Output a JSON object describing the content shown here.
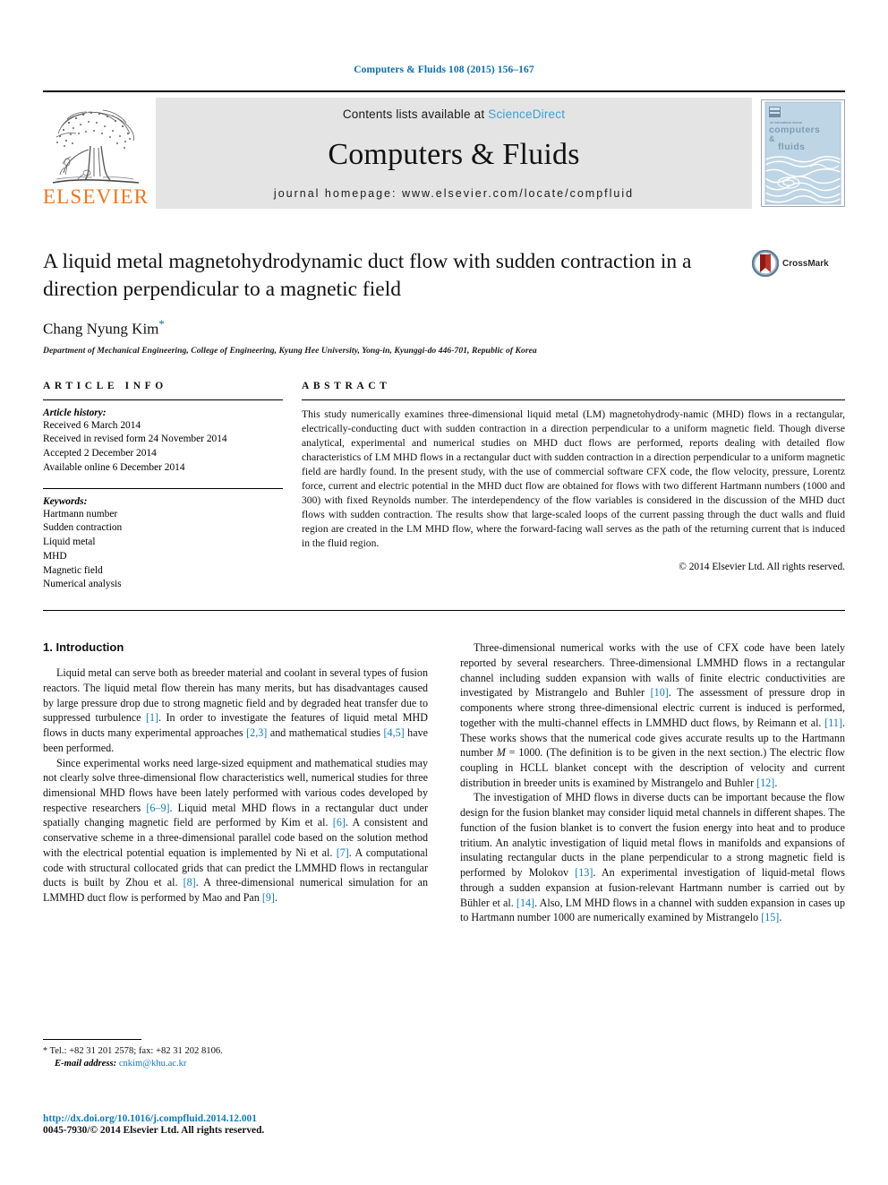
{
  "running_head": "Computers & Fluids 108 (2015) 156–167",
  "masthead": {
    "publisher_name": "ELSEVIER",
    "contents_prefix": "Contents lists available at ",
    "sciencedirect": "ScienceDirect",
    "journal_title": "Computers & Fluids",
    "homepage": "journal homepage: www.elsevier.com/locate/compfluid",
    "cover_line1": "An International Journal",
    "cover_line2": "computers",
    "cover_line3": "&",
    "cover_line4": "fluids"
  },
  "article": {
    "title": "A liquid metal magnetohydrodynamic duct flow with sudden contraction in a direction perpendicular to a magnetic field",
    "author": "Chang Nyung Kim",
    "author_marker": "*",
    "affiliation": "Department of Mechanical Engineering, College of Engineering, Kyung Hee University, Yong-in, Kyunggi-do 446-701, Republic of Korea",
    "crossmark_label": "CrossMark"
  },
  "info": {
    "heading": "ARTICLE INFO",
    "history_label": "Article history:",
    "history": [
      "Received 6 March 2014",
      "Received in revised form 24 November 2014",
      "Accepted 2 December 2014",
      "Available online 6 December 2014"
    ],
    "keywords_label": "Keywords:",
    "keywords": [
      "Hartmann number",
      "Sudden contraction",
      "Liquid metal",
      "MHD",
      "Magnetic field",
      "Numerical analysis"
    ]
  },
  "abstract": {
    "heading": "ABSTRACT",
    "text": "This study numerically examines three-dimensional liquid metal (LM) magnetohydrody-namic (MHD) flows in a rectangular, electrically-conducting duct with sudden contraction in a direction perpendicular to a uniform magnetic field. Though diverse analytical, experimental and numerical studies on MHD duct flows are performed, reports dealing with detailed flow characteristics of LM MHD flows in a rectangular duct with sudden contraction in a direction perpendicular to a uniform magnetic field are hardly found. In the present study, with the use of commercial software CFX code, the flow velocity, pressure, Lorentz force, current and electric potential in the MHD duct flow are obtained for flows with two different Hartmann numbers (1000 and 300) with fixed Reynolds number. The interdependency of the flow variables is considered in the discussion of the MHD duct flows with sudden contraction. The results show that large-scaled loops of the current passing through the duct walls and fluid region are created in the LM MHD flow, where the forward-facing wall serves as the path of the returning current that is induced in the fluid region.",
    "copyright": "© 2014 Elsevier Ltd. All rights reserved."
  },
  "body": {
    "section_number_title": "1. Introduction",
    "left_paragraphs": [
      "Liquid metal can serve both as breeder material and coolant in several types of fusion reactors. The liquid metal flow therein has many merits, but has disadvantages caused by large pressure drop due to strong magnetic field and by degraded heat transfer due to suppressed turbulence [1]. In order to investigate the features of liquid metal MHD flows in ducts many experimental approaches [2,3] and mathematical studies [4,5] have been performed.",
      "Since experimental works need large-sized equipment and mathematical studies may not clearly solve three-dimensional flow characteristics well, numerical studies for three dimensional MHD flows have been lately performed with various codes developed by respective researchers [6–9]. Liquid metal MHD flows in a rectangular duct under spatially changing magnetic field are performed by Kim et al. [6]. A consistent and conservative scheme in a three-dimensional parallel code based on the solution method with the electrical potential equation is implemented by Ni et al. [7]. A computational code with structural collocated grids that can predict the LMMHD flows in rectangular ducts is built by Zhou et al. [8]. A three-dimensional numerical simulation for an LMMHD duct flow is performed by Mao and Pan [9]."
    ],
    "right_paragraphs": [
      "Three-dimensional numerical works with the use of CFX code have been lately reported by several researchers. Three-dimensional LMMHD flows in a rectangular channel including sudden expansion with walls of finite electric conductivities are investigated by Mistrangelo and Buhler [10]. The assessment of pressure drop in components where strong three-dimensional electric current is induced is performed, together with the multi-channel effects in LMMHD duct flows, by Reimann et al. [11]. These works shows that the numerical code gives accurate results up to the Hartmann number M = 1000. (The definition is to be given in the next section.) The electric flow coupling in HCLL blanket concept with the description of velocity and current distribution in breeder units is examined by Mistrangelo and Buhler [12].",
      "The investigation of MHD flows in diverse ducts can be important because the flow design for the fusion blanket may consider liquid metal channels in different shapes. The function of the fusion blanket is to convert the fusion energy into heat and to produce tritium. An analytic investigation of liquid metal flows in manifolds and expansions of insulating rectangular ducts in the plane perpendicular to a strong magnetic field is performed by Molokov [13]. An experimental investigation of liquid-metal flows through a sudden expansion at fusion-relevant Hartmann number is carried out by Bühler et al. [14]. Also, LM MHD flows in a channel with sudden expansion in cases up to Hartmann number 1000 are numerically examined by Mistrangelo [15]."
    ]
  },
  "footnote": {
    "marker": "*",
    "tel_line": "Tel.: +82 31 201 2578; fax: +82 31 202 8106.",
    "email_label": "E-mail address:",
    "email": "cnkim@khu.ac.kr"
  },
  "footer": {
    "doi": "http://dx.doi.org/10.1016/j.compfluid.2014.12.001",
    "issn_line": "0045-7930/© 2014 Elsevier Ltd. All rights reserved."
  },
  "colors": {
    "link_blue": "#1379b5",
    "sciencedirect_blue": "#3c9fd4",
    "elsevier_orange": "#e87722",
    "cover_blue": "#b9d2e3"
  }
}
